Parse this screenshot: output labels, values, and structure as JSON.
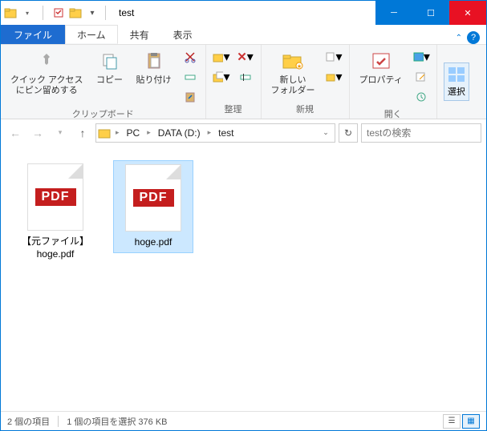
{
  "window": {
    "title": "test"
  },
  "menu": {
    "file": "ファイル",
    "home": "ホーム",
    "share": "共有",
    "view": "表示"
  },
  "ribbon": {
    "pin": "クイック アクセス\nにピン留めする",
    "copy": "コピー",
    "paste": "貼り付け",
    "clipboard_group": "クリップボード",
    "organize_group": "整理",
    "newfolder": "新しい\nフォルダー",
    "new_group": "新規",
    "properties": "プロパティ",
    "open_group": "開く",
    "select": "選択"
  },
  "breadcrumbs": {
    "pc": "PC",
    "drive": "DATA (D:)",
    "folder": "test"
  },
  "search": {
    "placeholder": "testの検索"
  },
  "files": [
    {
      "name": "【元ファイル】\nhoge.pdf",
      "badge": "PDF",
      "selected": false
    },
    {
      "name": "hoge.pdf",
      "badge": "PDF",
      "selected": true
    }
  ],
  "status": {
    "count": "2 個の項目",
    "selection": "1 個の項目を選択 376 KB"
  }
}
